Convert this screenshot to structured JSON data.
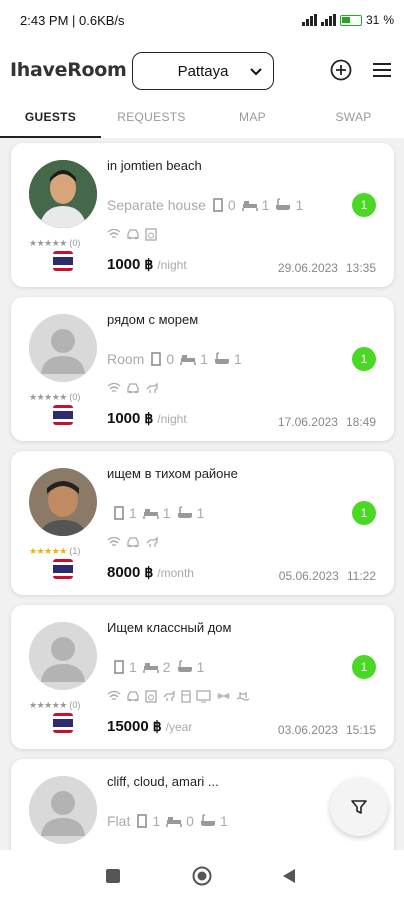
{
  "status_bar": {
    "time_speed": "2:43 PM | 0.6KB/s",
    "battery": "31"
  },
  "header": {
    "logo": "IhaveRoom",
    "city": "Pattaya"
  },
  "tabs": [
    {
      "label": "GUESTS",
      "active": true
    },
    {
      "label": "REQUESTS",
      "active": false
    },
    {
      "label": "MAP",
      "active": false
    },
    {
      "label": "SWAP",
      "active": false
    }
  ],
  "cards": [
    {
      "title": "in jomtien beach",
      "type": "Separate house",
      "rooms": "0",
      "beds": "1",
      "baths": "1",
      "stars": "★★★★★",
      "rating_count": "(0)",
      "badge": "1",
      "price": "1000",
      "currency": "฿",
      "period": "/night",
      "date": "29.06.2023",
      "time": "13:35"
    },
    {
      "title": "рядом с морем",
      "type": "Room",
      "rooms": "0",
      "beds": "1",
      "baths": "1",
      "stars": "★★★★★",
      "rating_count": "(0)",
      "badge": "1",
      "price": "1000",
      "currency": "฿",
      "period": "/night",
      "date": "17.06.2023",
      "time": "18:49"
    },
    {
      "title": "ищем в тихом районе",
      "type": "",
      "rooms": "1",
      "beds": "1",
      "baths": "1",
      "stars": "★★★★★",
      "rating_count": "(1)",
      "badge": "1",
      "price": "8000",
      "currency": "฿",
      "period": "/month",
      "date": "05.06.2023",
      "time": "11:22"
    },
    {
      "title": "Ищем классный дом",
      "type": "",
      "rooms": "1",
      "beds": "2",
      "baths": "1",
      "stars": "★★★★★",
      "rating_count": "(0)",
      "badge": "1",
      "price": "15000",
      "currency": "฿",
      "period": "/year",
      "date": "03.06.2023",
      "time": "15:15"
    },
    {
      "title": "cliff, cloud, amari ...",
      "type": "Flat",
      "rooms": "1",
      "beds": "0",
      "baths": "1"
    }
  ],
  "colors": {
    "badge": "#49d924",
    "star_gold": "#f2b300",
    "accent": "#222222"
  }
}
